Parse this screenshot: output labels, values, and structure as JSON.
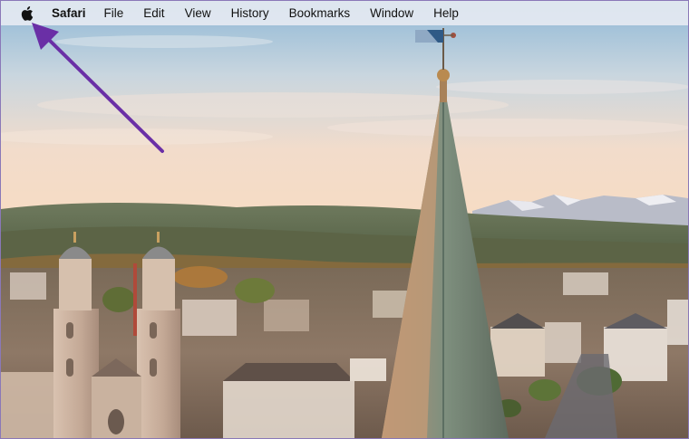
{
  "menubar": {
    "apple_icon": "apple-logo-icon",
    "app_name": "Safari",
    "items": [
      "File",
      "Edit",
      "View",
      "History",
      "Bookmarks",
      "Window",
      "Help"
    ]
  },
  "annotation": {
    "arrow_color": "#6a2fa6",
    "points_to": "apple-logo-icon"
  },
  "colors": {
    "menubar_bg": "#e8ecf2",
    "sky_top": "#9fc3dc",
    "sky_horizon": "#f4d9c2",
    "frame_border": "#8a78b8"
  }
}
